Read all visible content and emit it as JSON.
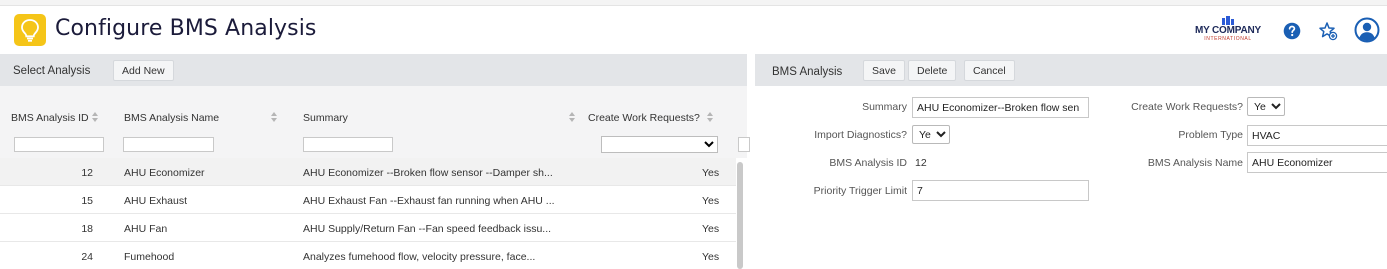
{
  "header": {
    "title": "Configure BMS Analysis",
    "logo_name": "MY COMPANY",
    "logo_sub": "INTERNATIONAL",
    "help_icon": "help-circle-icon",
    "favorite_icon": "star-add-icon",
    "user_icon": "user-avatar-icon",
    "accent": "#f5c518",
    "icon_color": "#1a5fb4"
  },
  "left": {
    "title": "Select Analysis",
    "add_new_label": "Add New",
    "columns": [
      "BMS Analysis ID",
      "BMS Analysis Name",
      "Summary",
      "Create Work Requests?"
    ],
    "rows": [
      {
        "id": "12",
        "name": "AHU Economizer",
        "summary": "AHU Economizer --Broken flow sensor --Damper sh...",
        "create_wr": "Yes"
      },
      {
        "id": "15",
        "name": "AHU Exhaust",
        "summary": "AHU Exhaust Fan --Exhaust fan running when AHU ...",
        "create_wr": "Yes"
      },
      {
        "id": "18",
        "name": "AHU Fan",
        "summary": "AHU Supply/Return Fan --Fan speed feedback issu...",
        "create_wr": "Yes"
      },
      {
        "id": "24",
        "name": "Fumehood",
        "summary": "Analyzes fumehood flow, velocity pressure, face...",
        "create_wr": "Yes"
      }
    ]
  },
  "right": {
    "title": "BMS Analysis",
    "save_label": "Save",
    "delete_label": "Delete",
    "cancel_label": "Cancel",
    "summary_label": "Summary",
    "summary_value": "AHU Economizer--Broken flow sen",
    "import_diag_label": "Import Diagnostics?",
    "import_diag_value": "Yes",
    "bms_id_label": "BMS Analysis ID",
    "bms_id_value": "12",
    "priority_label": "Priority Trigger Limit",
    "priority_value": "7",
    "create_wr_label": "Create Work Requests?",
    "create_wr_value": "Yes",
    "problem_type_label": "Problem Type",
    "problem_type_value": "HVAC",
    "bms_name_label": "BMS Analysis Name",
    "bms_name_value": "AHU Economizer"
  }
}
